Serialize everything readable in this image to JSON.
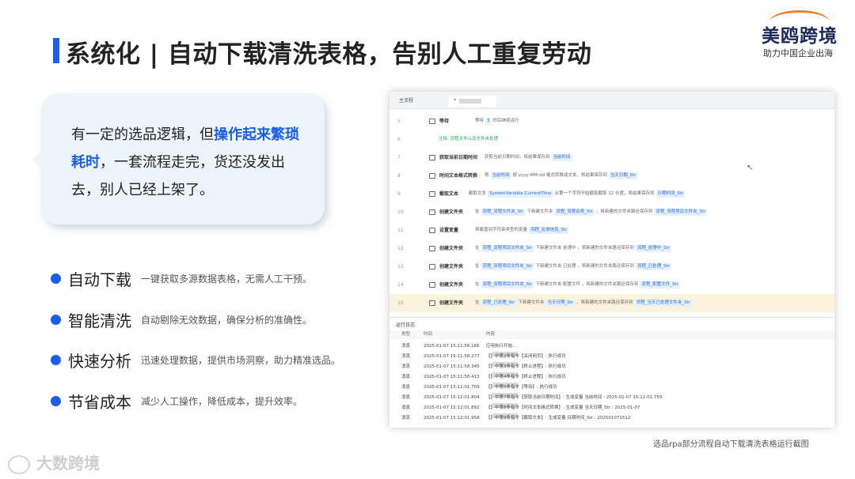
{
  "slide": {
    "title": "系统化 | 自动下载清洗表格，告别人工重复劳动",
    "accent_color": "#1a5eea"
  },
  "logo": {
    "brand": "美鸥跨境",
    "tagline": "助力中国企业出海"
  },
  "callout": {
    "text_before": "有一定的选品逻辑，但",
    "highlight": "操作起来繁琐耗时",
    "text_after": "，一套流程走完，货还没发出去，别人已经上架了。"
  },
  "features": [
    {
      "name": "自动下载",
      "desc": "一键获取多源数据表格，无需人工干预。"
    },
    {
      "name": "智能清洗",
      "desc": "自动剔除无效数据，确保分析的准确性。"
    },
    {
      "name": "快速分析",
      "desc": "迅速处理数据，提供市场洞察，助力精准选品。"
    },
    {
      "name": "节省成本",
      "desc": "减少人工操作，降低成本，提升效率。"
    }
  ],
  "screenshot": {
    "tabs": {
      "main": "主流程",
      "current": "*"
    },
    "rows": [
      {
        "num": "5",
        "cmd": "等待",
        "args": "等待",
        "pill1": "3",
        "args2": "秒后继续运行",
        "pill2": "",
        "args3": "",
        "pill3": ""
      },
      {
        "num": "6",
        "note": "注释: 流程文件以及文件夹处理"
      },
      {
        "num": "7",
        "cmd": "获取当前日期时间",
        "args": "获取当前日期时间，将结果保存到",
        "pill1": "当前时间",
        "args2": "",
        "pill2": "",
        "args3": "",
        "pill3": ""
      },
      {
        "num": "8",
        "cmd": "时间文本格式转换",
        "args": "将",
        "pill1": "当前时间",
        "args2": "按 yyyy-MM-dd 格式转换成文本，将结果保存到",
        "pill2": "当天日期_Str",
        "args3": "",
        "pill3": ""
      },
      {
        "num": "9",
        "cmd": "截取文本",
        "args": "截取文本",
        "pill1": "SystemVariable.CurrentTime",
        "args2": "从第一个字符开始截取截取 12 长度，将结果保存到",
        "pill2": "日期时间_Str",
        "args3": "",
        "pill3": ""
      },
      {
        "num": "10",
        "cmd": "创建文件夹",
        "args": "在",
        "pill1": "流程_流程文件夹_Str",
        "args2": "下新建文件夹",
        "pill2": "流程_流程名称_Str",
        "args3": "，将新建的文件夹路径保存到",
        "pill3": "流程_流程项目文件夹_Str"
      },
      {
        "num": "11",
        "cmd": "设置变量",
        "args": "将",
        "pill1": "",
        "args2": "赋值到字符串类型的变量",
        "pill2": "流程_反馈信息_Str",
        "args3": "",
        "pill3": ""
      },
      {
        "num": "12",
        "cmd": "创建文件夹",
        "args": "在",
        "pill1": "流程_流程项目文件夹_Str",
        "args2": "下新建文件夹 处理中 ，将新建的文件夹路径保存到",
        "pill2": "流程_处理中_Str",
        "args3": "",
        "pill3": ""
      },
      {
        "num": "13",
        "cmd": "创建文件夹",
        "args": "在",
        "pill1": "流程_流程项目文件夹_Str",
        "args2": "下新建文件夹 已处理 ，将新建的文件夹路径保存到",
        "pill2": "流程_已处理_Str",
        "args3": "",
        "pill3": ""
      },
      {
        "num": "14",
        "cmd": "创建文件夹",
        "args": "在",
        "pill1": "流程_流程项目文件夹_Str",
        "args2": "下新建文件夹 配置文件 ，将新建的文件夹路径保存到",
        "pill2": "流程_配置文件_Str",
        "args3": "",
        "pill3": ""
      },
      {
        "num": "15",
        "cmd": "创建文件夹",
        "args": "在",
        "pill1": "流程_已处理_Str",
        "args2": "下新建文件夹",
        "pill2": "当天日期_Str",
        "args3": "，将新建的文件夹路径保存到",
        "pill3": "流程_当天已处理文件夹_Str"
      }
    ],
    "log": {
      "title": "运行日志",
      "col_type": "类型",
      "col_time": "时间",
      "col_content": "内容",
      "rows": [
        {
          "type": "消息",
          "time": "2025-01-07 15:11:56.166",
          "content": "应用执行开始..."
        },
        {
          "type": "消息",
          "time": "2025-01-07 15:11:58.277",
          "content": "】中第2条指令【关闭网页】: 执行成功"
        },
        {
          "type": "消息",
          "time": "2025-01-07 15:11:58.345",
          "content": "】中第3条指令【终止进程】: 执行成功"
        },
        {
          "type": "消息",
          "time": "2025-01-07 15:11:58.413",
          "content": "】中第4条指令【终止进程】: 执行成功"
        },
        {
          "type": "消息",
          "time": "2025-01-07 15:12:01.709",
          "content": "】中第5条指令【等待】: 执行成功"
        },
        {
          "type": "消息",
          "time": "2025-01-07 15:12:01.804",
          "content": "】中第7条指令【获取当前日期时间】: 生成变量 当前时间 : 2025-01-07 15:12:01.759"
        },
        {
          "type": "消息",
          "time": "2025-01-07 15:12:01.892",
          "content": "】中第8条指令【时间文本格式转换】: 生成变量 当天日期_Str : 2025-01-07"
        },
        {
          "type": "消息",
          "time": "2025-01-07 15:12:01.958",
          "content": "】中第9条指令【截取文本】: 生成变量 日期时间_Str : 202501071512"
        }
      ]
    }
  },
  "caption": "选品rpa部分流程自动下载清洗表格运行截图",
  "watermark": "大数跨境"
}
